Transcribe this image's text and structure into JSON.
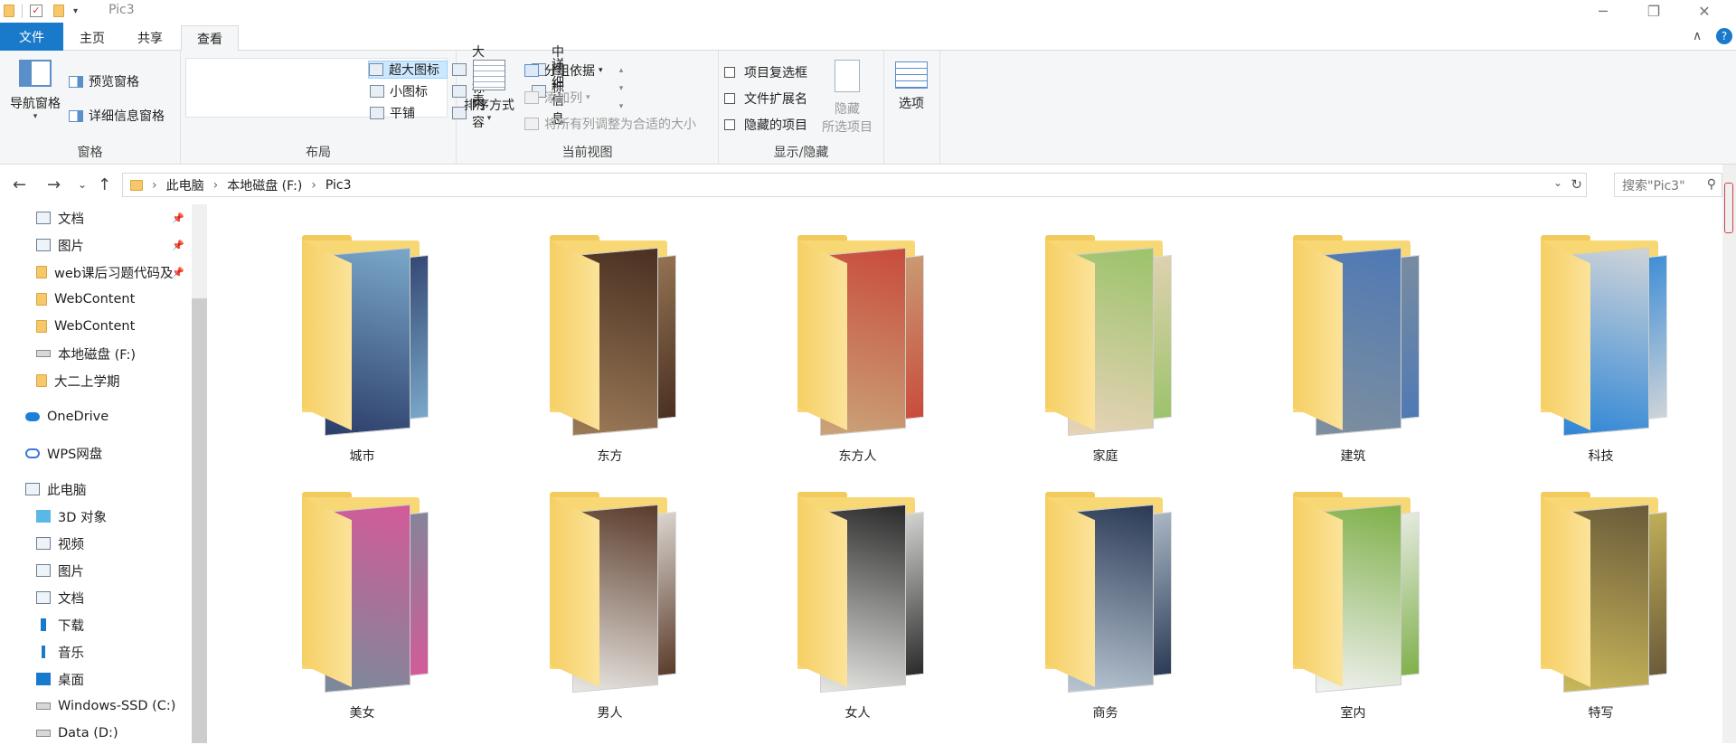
{
  "window": {
    "title": "Pic3",
    "minimize": "─",
    "maximize": "❐",
    "close": "✕"
  },
  "tabs": [
    {
      "label": "文件"
    },
    {
      "label": "主页"
    },
    {
      "label": "共享"
    },
    {
      "label": "查看"
    }
  ],
  "ribbon": {
    "panes": {
      "label": "窗格",
      "nav_pane": "导航窗格",
      "preview_pane": "预览窗格",
      "details_pane": "详细信息窗格"
    },
    "layout": {
      "label": "布局",
      "items": [
        "超大图标",
        "大图标",
        "中图标",
        "小图标",
        "列表",
        "详细信息",
        "平铺",
        "内容"
      ]
    },
    "current_view": {
      "label": "当前视图",
      "sort": "排序方式",
      "group": "分组依据",
      "add_column": "添加列",
      "fit_columns": "将所有列调整为合适的大小"
    },
    "show_hide": {
      "label": "显示/隐藏",
      "item_checkbox": "项目复选框",
      "file_ext": "文件扩展名",
      "hidden_items": "隐藏的项目",
      "hide_selected_1": "隐藏",
      "hide_selected_2": "所选项目"
    },
    "options": "选项"
  },
  "address": {
    "crumbs": [
      "此电脑",
      "本地磁盘 (F:)",
      "Pic3"
    ],
    "search_placeholder": "搜索\"Pic3\""
  },
  "sidebar": {
    "items": [
      {
        "label": "文档",
        "pinned": true
      },
      {
        "label": "图片",
        "pinned": true
      },
      {
        "label": "web课后习题代码及",
        "pinned": true
      },
      {
        "label": "WebContent",
        "pinned": false
      },
      {
        "label": "WebContent",
        "pinned": false
      },
      {
        "label": "本地磁盘 (F:)",
        "pinned": false
      },
      {
        "label": "大二上学期",
        "pinned": false
      },
      {
        "label": "OneDrive",
        "pinned": false
      },
      {
        "label": "WPS网盘",
        "pinned": false
      },
      {
        "label": "此电脑",
        "pinned": false
      },
      {
        "label": "3D 对象",
        "pinned": false
      },
      {
        "label": "视频",
        "pinned": false
      },
      {
        "label": "图片",
        "pinned": false
      },
      {
        "label": "文档",
        "pinned": false
      },
      {
        "label": "下载",
        "pinned": false
      },
      {
        "label": "音乐",
        "pinned": false
      },
      {
        "label": "桌面",
        "pinned": false
      },
      {
        "label": "Windows-SSD (C:)",
        "pinned": false
      },
      {
        "label": "Data (D:)",
        "pinned": false
      }
    ]
  },
  "folders": [
    {
      "name": "城市",
      "c1": "#2c3e6b",
      "c2": "#7aa8c9"
    },
    {
      "name": "东方",
      "c1": "#9b7a57",
      "c2": "#4a3022"
    },
    {
      "name": "东方人",
      "c1": "#c9a47a",
      "c2": "#c94b3b"
    },
    {
      "name": "家庭",
      "c1": "#e8d3b8",
      "c2": "#9bc36b"
    },
    {
      "name": "建筑",
      "c1": "#7e8f9e",
      "c2": "#4f79b5"
    },
    {
      "name": "科技",
      "c1": "#2f86d6",
      "c2": "#cfd4d8"
    },
    {
      "name": "美女",
      "c1": "#7a8a9a",
      "c2": "#d45a9a"
    },
    {
      "name": "男人",
      "c1": "#e9e6e2",
      "c2": "#5a3b2a"
    },
    {
      "name": "女人",
      "c1": "#e6e6e3",
      "c2": "#2a2a2a"
    },
    {
      "name": "商务",
      "c1": "#b8c6d3",
      "c2": "#2b3a55"
    },
    {
      "name": "室内",
      "c1": "#f1f1f1",
      "c2": "#7fb04a"
    },
    {
      "name": "特写",
      "c1": "#c9b85a",
      "c2": "#6a5a3a"
    }
  ]
}
